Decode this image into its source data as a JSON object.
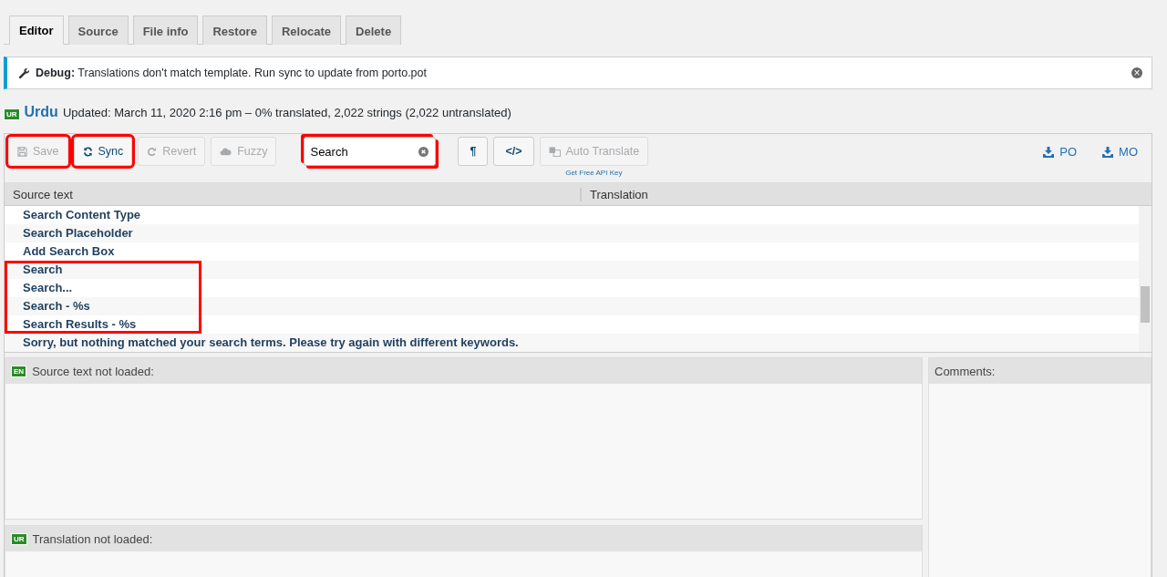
{
  "tabs": [
    {
      "label": "Editor",
      "selected": true
    },
    {
      "label": "Source",
      "selected": false
    },
    {
      "label": "File info",
      "selected": false
    },
    {
      "label": "Restore",
      "selected": false
    },
    {
      "label": "Relocate",
      "selected": false
    },
    {
      "label": "Delete",
      "selected": false
    }
  ],
  "notice": {
    "label": "Debug:",
    "text": "Translations don't match template. Run sync to update from porto.pot",
    "close": "×"
  },
  "locale": {
    "badge": "UR",
    "name": "Urdu",
    "summary": "Updated: March 11, 2020 2:16 pm – 0% translated, 2,022 strings (2,022 untranslated)"
  },
  "toolbar": {
    "buttons": [
      {
        "kind": "save",
        "label": "Save",
        "disabled": true,
        "highlighted": true
      },
      {
        "kind": "sync",
        "label": "Sync",
        "disabled": false,
        "highlighted": true
      },
      {
        "kind": "revert",
        "label": "Revert",
        "disabled": true,
        "highlighted": false
      },
      {
        "kind": "fuzzy",
        "label": "Fuzzy",
        "disabled": true,
        "highlighted": false
      }
    ],
    "search": {
      "value": "Search",
      "highlighted": true
    },
    "toggles": [
      {
        "label": "¶"
      },
      {
        "label": "</>"
      }
    ],
    "auto_translate": {
      "label": "Auto Translate",
      "disabled": true,
      "link": "Get Free API Key"
    },
    "downloads": [
      {
        "label": "PO"
      },
      {
        "label": "MO"
      }
    ]
  },
  "table": {
    "columns": [
      "Source text",
      "Translation"
    ],
    "groups": [
      {
        "highlighted": false,
        "rows": [
          "Search Content Type",
          "Search Placeholder",
          "Add Search Box"
        ]
      },
      {
        "highlighted": true,
        "rows": [
          "Search",
          "Search...",
          "Search - %s",
          "Search Results - %s"
        ]
      },
      {
        "highlighted": false,
        "rows": [
          "Sorry, but nothing matched your search terms. Please try again with different keywords."
        ]
      }
    ]
  },
  "source_pane": {
    "badge": "EN",
    "title": "Source text not loaded:"
  },
  "translation_pane": {
    "badge": "UR",
    "title": "Translation not loaded:"
  },
  "comments_pane": {
    "title": "Comments:"
  }
}
